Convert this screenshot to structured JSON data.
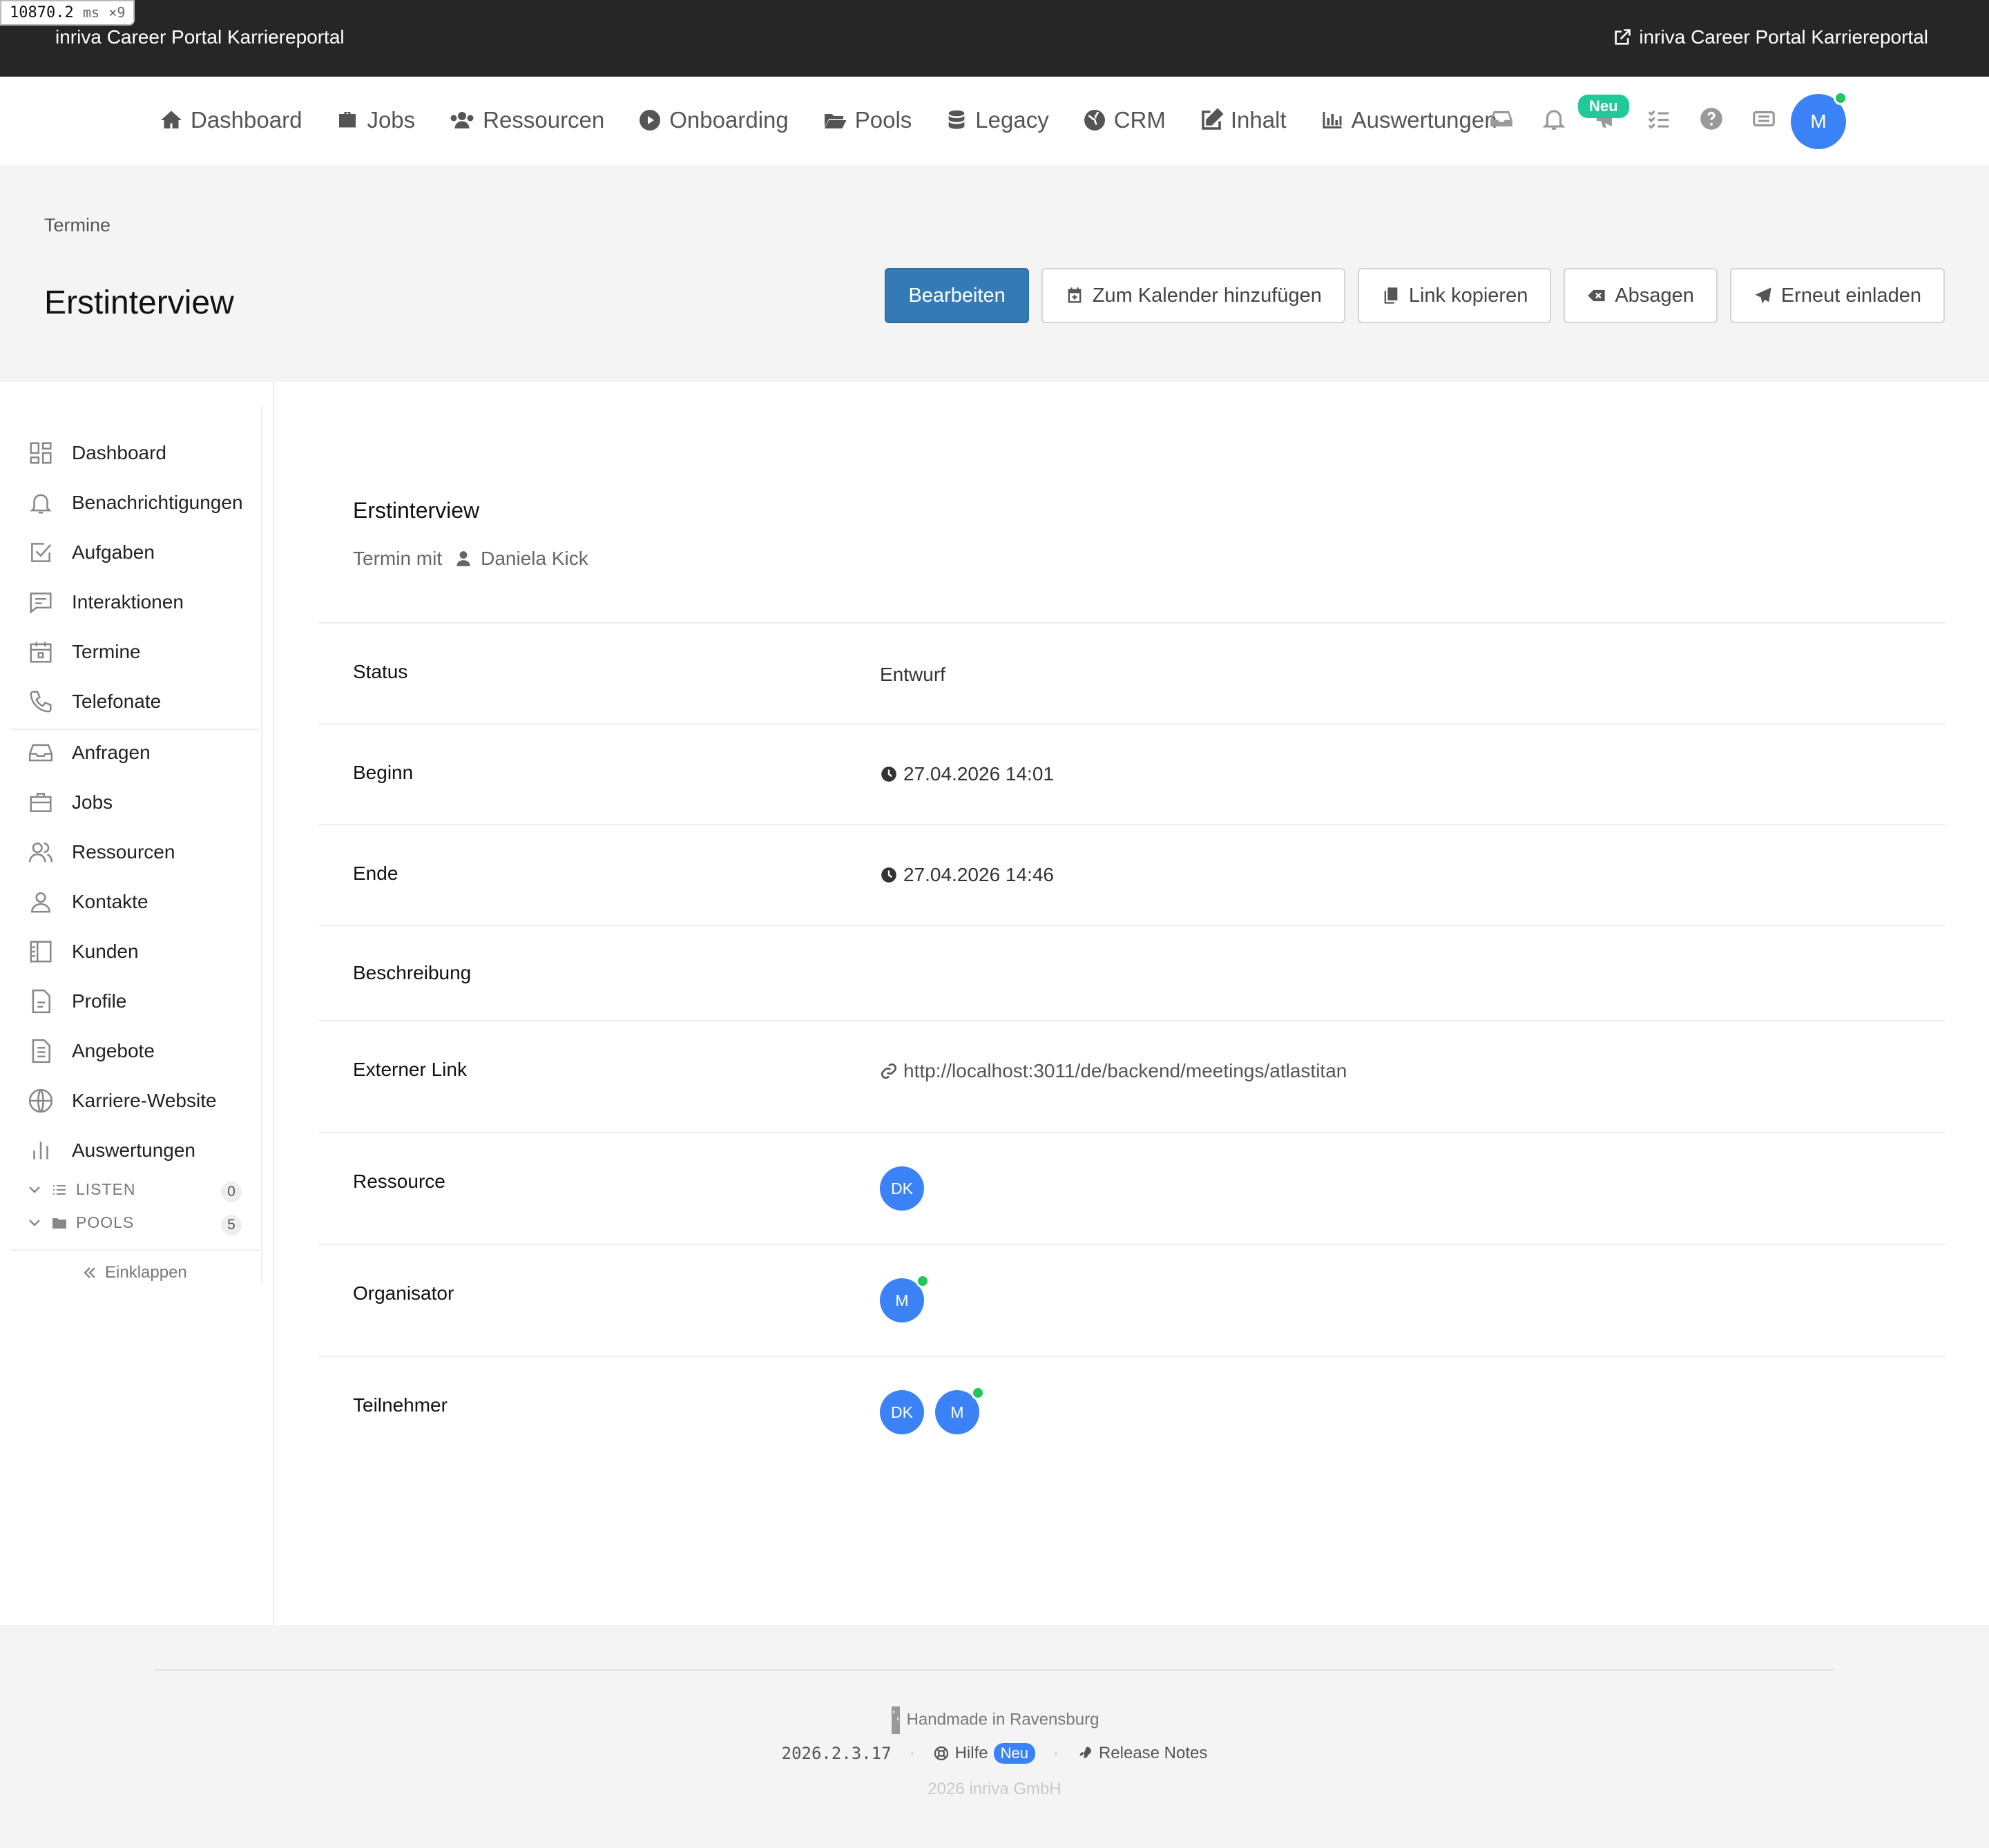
{
  "debug": {
    "timing_value": "10870.2",
    "timing_unit": "ms",
    "timing_count": "×9"
  },
  "topbar": {
    "brand": "inriva Career Portal Karriereportal",
    "external_link": "inriva Career Portal Karriereportal"
  },
  "nav": {
    "items": [
      {
        "label": "Dashboard",
        "icon": "home-icon"
      },
      {
        "label": "Jobs",
        "icon": "briefcase-icon"
      },
      {
        "label": "Ressourcen",
        "icon": "users-icon"
      },
      {
        "label": "Onboarding",
        "icon": "play-circle-icon"
      },
      {
        "label": "Pools",
        "icon": "folder-open-icon"
      },
      {
        "label": "Legacy",
        "icon": "database-icon"
      },
      {
        "label": "CRM",
        "icon": "globe-icon"
      },
      {
        "label": "Inhalt",
        "icon": "edit-icon"
      },
      {
        "label": "Auswertungen",
        "icon": "bar-chart-icon"
      }
    ],
    "neu_badge": "Neu",
    "avatar": "M"
  },
  "header": {
    "breadcrumb": "Termine",
    "title": "Erstinterview",
    "actions": {
      "edit": "Bearbeiten",
      "add_calendar": "Zum Kalender hinzufügen",
      "copy_link": "Link kopieren",
      "cancel": "Absagen",
      "reinvite": "Erneut einladen"
    }
  },
  "sidebar": {
    "items": [
      {
        "label": "Dashboard",
        "icon": "grid-icon"
      },
      {
        "label": "Benachrichtigungen",
        "icon": "bell-icon"
      },
      {
        "label": "Aufgaben",
        "icon": "check-square-icon"
      },
      {
        "label": "Interaktionen",
        "icon": "message-icon"
      },
      {
        "label": "Termine",
        "icon": "calendar-icon"
      },
      {
        "label": "Telefonate",
        "icon": "phone-icon"
      },
      {
        "label": "Anfragen",
        "icon": "inbox-icon"
      },
      {
        "label": "Jobs",
        "icon": "briefcase-icon"
      },
      {
        "label": "Ressourcen",
        "icon": "users-icon"
      },
      {
        "label": "Kontakte",
        "icon": "user-icon"
      },
      {
        "label": "Kunden",
        "icon": "building-icon"
      },
      {
        "label": "Profile",
        "icon": "file-icon"
      },
      {
        "label": "Angebote",
        "icon": "document-icon"
      },
      {
        "label": "Karriere-Website",
        "icon": "globe-icon"
      },
      {
        "label": "Auswertungen",
        "icon": "bar-chart-icon"
      }
    ],
    "groups": [
      {
        "label": "LISTEN",
        "count": "0"
      },
      {
        "label": "POOLS",
        "count": "5"
      }
    ],
    "collapse": "Einklappen"
  },
  "detail": {
    "title": "Erstinterview",
    "subtitle_prefix": "Termin mit",
    "subtitle_person": "Daniela Kick",
    "rows": {
      "status": {
        "label": "Status",
        "value": "Entwurf"
      },
      "begin": {
        "label": "Beginn",
        "value": "27.04.2026 14:01"
      },
      "end": {
        "label": "Ende",
        "value": "27.04.2026 14:46"
      },
      "description": {
        "label": "Beschreibung",
        "value": ""
      },
      "external_link": {
        "label": "Externer Link",
        "value": "http://localhost:3011/de/backend/meetings/atlastitan"
      },
      "resource": {
        "label": "Ressource",
        "avatars": [
          "DK"
        ]
      },
      "organizer": {
        "label": "Organisator",
        "avatars": [
          "M"
        ]
      },
      "participants": {
        "label": "Teilnehmer",
        "avatars": [
          "DK",
          "M"
        ]
      }
    }
  },
  "footer": {
    "handmade": "Handmade in Ravensburg",
    "version": "2026.2.3.17",
    "help": "Hilfe",
    "help_badge": "Neu",
    "release_notes": "Release Notes",
    "copyright": "2026 inriva GmbH"
  },
  "colors": {
    "primary": "#337ab7",
    "avatar": "#3b82f6",
    "online": "#22c55e",
    "badge": "#20c997",
    "topbar": "#262626"
  }
}
